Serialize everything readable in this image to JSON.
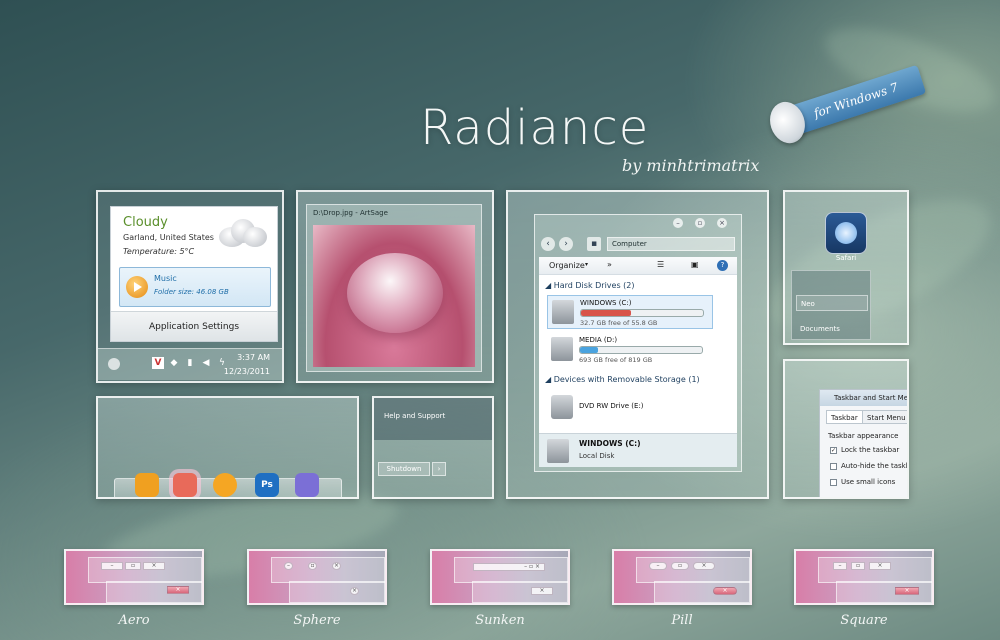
{
  "header": {
    "title": "Radiance",
    "byline": "by minhtrimatrix",
    "ribbon": "for Windows 7"
  },
  "gadget": {
    "weather": {
      "condition": "Cloudy",
      "location": "Garland, United States",
      "temperature": "Temperature: 5°C"
    },
    "music": {
      "title": "Music",
      "folder_size": "Folder size: 46.08 GB"
    },
    "settings_label": "Application Settings",
    "tray": {
      "time": "3:37 AM",
      "date": "12/23/2011"
    }
  },
  "viewer": {
    "title": "D:\\Drop.jpg - ArtSage"
  },
  "explorer": {
    "address": "Computer",
    "toolbar": {
      "organize": "Organize"
    },
    "groups": [
      {
        "label": "Hard Disk Drives (2)"
      },
      {
        "label": "Devices with Removable Storage (1)"
      }
    ],
    "drives": [
      {
        "name": "WINDOWS (C:)",
        "free": "32.7 GB free of 55.8 GB",
        "used_fraction": 0.41,
        "bar_color": "#d8544a"
      },
      {
        "name": "MEDIA (D:)",
        "free": "693 GB free of 819 GB",
        "used_fraction": 0.15,
        "bar_color": "#4aa3df"
      },
      {
        "name": "DVD RW Drive (E:)"
      }
    ],
    "footer": {
      "name": "WINDOWS (C:)",
      "type": "Local Disk"
    }
  },
  "startmenu": {
    "pinned": "Safari",
    "items": [
      {
        "label": "Neo"
      },
      {
        "label": "Documents"
      }
    ]
  },
  "taskbar_dialog": {
    "title": "Taskbar and Start Menu",
    "tabs": [
      {
        "label": "Taskbar"
      },
      {
        "label": "Start Menu"
      }
    ],
    "section": "Taskbar appearance",
    "options": [
      {
        "label": "Lock the taskbar",
        "checked": true
      },
      {
        "label": "Auto-hide the taskbar",
        "checked": false
      },
      {
        "label": "Use small icons",
        "checked": false
      }
    ]
  },
  "dock": {
    "icons": [
      {
        "icon": "folder-icon",
        "glyph": "",
        "color": "#f0a020"
      },
      {
        "icon": "app-icon",
        "glyph": "",
        "color": "#e86a5a"
      },
      {
        "icon": "media-player-icon",
        "glyph": "",
        "color": "#f5a623"
      },
      {
        "icon": "photoshop-icon",
        "glyph": "Ps",
        "color": "#1f6fc2"
      },
      {
        "icon": "messenger-icon",
        "glyph": "",
        "color": "#7b6fd6"
      }
    ]
  },
  "power": {
    "help": "Help and Support",
    "shutdown": "Shutdown",
    "arrow": "›"
  },
  "styles": [
    {
      "label": "Aero"
    },
    {
      "label": "Sphere"
    },
    {
      "label": "Sunken"
    },
    {
      "label": "Pill"
    },
    {
      "label": "Square"
    }
  ]
}
